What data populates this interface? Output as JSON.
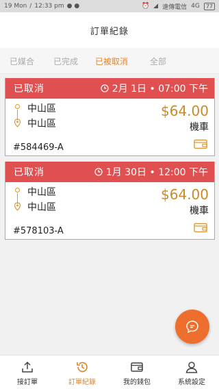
{
  "status_bar": {
    "date": "19 Mon",
    "time": "12:33 pm",
    "carrier": "遠傳電信",
    "network": "4G",
    "battery": "77"
  },
  "header": {
    "title": "訂單紀錄"
  },
  "tabs": [
    {
      "label": "已媒合"
    },
    {
      "label": "已完成"
    },
    {
      "label": "已被取消"
    },
    {
      "label": "全部"
    }
  ],
  "orders": [
    {
      "status": "已取消",
      "datetime": "2月 1日 • 07:00 下午",
      "from": "中山區",
      "to": "中山區",
      "price": "$64.00",
      "vehicle": "機車",
      "order_no": "#584469-A"
    },
    {
      "status": "已取消",
      "datetime": "1月 30日 • 12:00 下午",
      "from": "中山區",
      "to": "中山區",
      "price": "$64.00",
      "vehicle": "機車",
      "order_no": "#578103-A"
    }
  ],
  "bottom_nav": [
    {
      "label": "接訂單",
      "icon": "upload-icon"
    },
    {
      "label": "訂單紀錄",
      "icon": "history-icon"
    },
    {
      "label": "我的錢包",
      "icon": "wallet-icon"
    },
    {
      "label": "系統設定",
      "icon": "user-icon"
    }
  ],
  "colors": {
    "accent": "#e6842b",
    "card_header": "#e05050",
    "price": "#c98a2a",
    "fab": "#ee6e2e"
  }
}
